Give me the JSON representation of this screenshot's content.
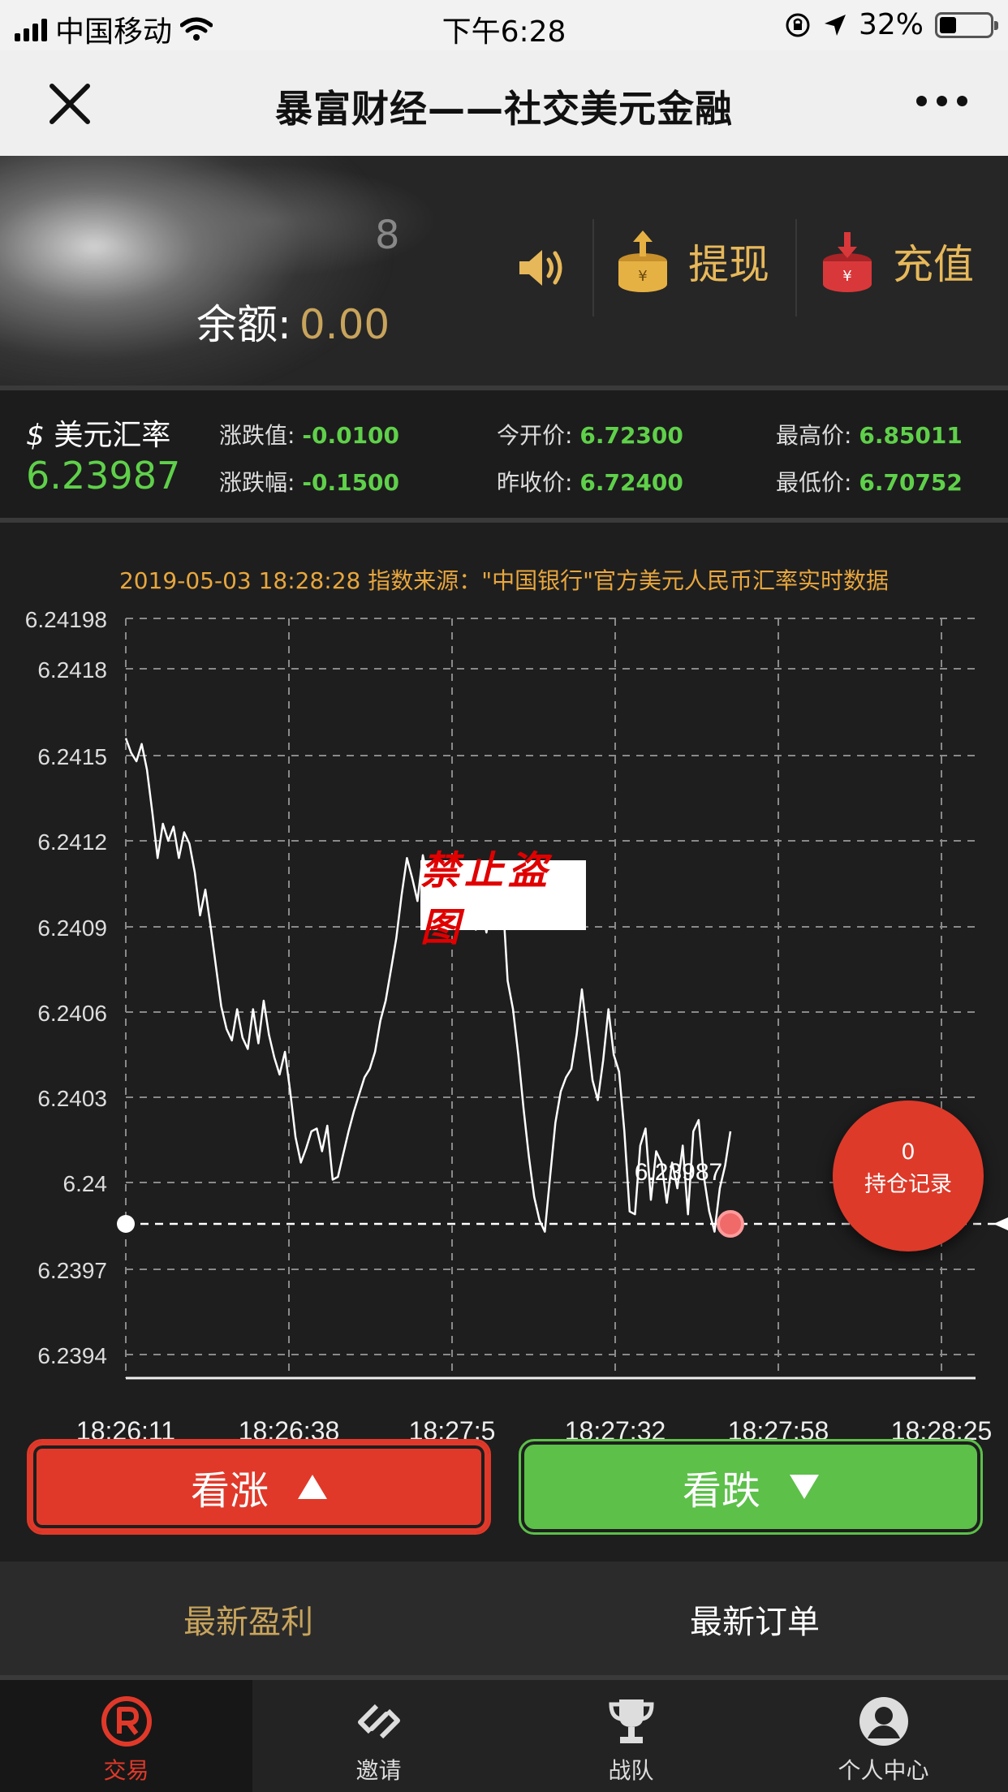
{
  "status_bar": {
    "carrier": "中国移动",
    "time": "下午6:28",
    "battery": "32%",
    "battery_level": 0.32
  },
  "nav": {
    "title": "暴富财经——社交美元金融",
    "close_icon": "close-icon",
    "more_icon": "more-icon"
  },
  "header": {
    "uid": "8",
    "balance_label": "余额:",
    "balance_value": "0.00",
    "withdraw_label": "提现",
    "recharge_label": "充值",
    "colors": {
      "gold": "#e7b85a",
      "coin": "#e6b143",
      "red_coin": "#d9383a"
    }
  },
  "rate": {
    "symbol": "$",
    "label": "美元汇率",
    "price": "6.23987",
    "change_label": "涨跌值:",
    "change_value": "-0.0100",
    "change_pct_label": "涨跌幅:",
    "change_pct_value": "-0.1500",
    "open_label": "今开价:",
    "open_value": "6.72300",
    "prev_close_label": "昨收价:",
    "prev_close_value": "6.72400",
    "high_label": "最高价:",
    "high_value": "6.85011",
    "low_label": "最低价:",
    "low_value": "6.70752",
    "colors": {
      "up_green": "#5fd04a"
    }
  },
  "chart_header": {
    "source": "2019-05-03 18:28:28 指数来源：\"中国银行\"官方美元人民币汇率实时数据"
  },
  "chart_data": {
    "type": "line",
    "y_ticks": [
      "6.24198",
      "6.2418",
      "6.2415",
      "6.2412",
      "6.2409",
      "6.2406",
      "6.2403",
      "6.24",
      "6.2397",
      "6.2394"
    ],
    "x_ticks": [
      "18:26:11",
      "18:26:38",
      "18:27:5",
      "18:27:32",
      "18:27:58",
      "18:28:25"
    ],
    "ylim": [
      6.2394,
      6.24198
    ],
    "current_value": 6.23987,
    "current_label": "6.23987",
    "grid": true,
    "series": [
      {
        "values": [
          6.24156,
          6.24151,
          6.24148,
          6.24154,
          6.24145,
          6.2413,
          6.24114,
          6.24126,
          6.2412,
          6.24125,
          6.24114,
          6.24123,
          6.24119,
          6.24109,
          6.24094,
          6.24103,
          6.2409,
          6.24076,
          6.24062,
          6.24054,
          6.2405,
          6.24061,
          6.24051,
          6.24047,
          6.24061,
          6.24049,
          6.24064,
          6.24052,
          6.24044,
          6.24038,
          6.24046,
          6.24032,
          6.24016,
          6.24007,
          6.24012,
          6.24018,
          6.24019,
          6.24011,
          6.2402,
          6.24001,
          6.24002,
          6.2401,
          6.24018,
          6.24025,
          6.24031,
          6.24037,
          6.2404,
          6.24046,
          6.24057,
          6.24064,
          6.24075,
          6.24086,
          6.24101,
          6.24114,
          6.24107,
          6.24099,
          6.24115,
          6.24106,
          6.24103,
          6.24097,
          6.24094,
          6.24101,
          6.24102,
          6.24099,
          6.24093,
          6.24103,
          6.24089,
          6.24096,
          6.24088,
          6.24101,
          6.2411,
          6.24102,
          6.24071,
          6.24061,
          6.24045,
          6.24026,
          6.24009,
          6.23995,
          6.23987,
          6.23983,
          6.24002,
          6.24021,
          6.24032,
          6.24037,
          6.2404,
          6.24052,
          6.24068,
          6.24052,
          6.24036,
          6.24029,
          6.24043,
          6.24061,
          6.24045,
          6.24039,
          6.24018,
          6.2399,
          6.23989,
          6.24013,
          6.24019,
          6.23994,
          6.24011,
          6.24007,
          6.23993,
          6.24007,
          6.23998,
          6.24013,
          6.23989,
          6.24018,
          6.24022,
          6.24002,
          6.2399,
          6.23983,
          6.23998,
          6.24006,
          6.24018
        ]
      }
    ]
  },
  "watermark": "禁止盗图",
  "hold_badge": {
    "count": "0",
    "label": "持仓记录",
    "color": "#dd3a2a"
  },
  "actions": {
    "buy_up_label": "看涨",
    "buy_down_label": "看跌",
    "colors": {
      "up": "#e0392a",
      "down": "#5cc049"
    }
  },
  "tabs": [
    {
      "label": "最新盈利",
      "active": true
    },
    {
      "label": "最新订单",
      "active": false
    }
  ],
  "bottom_nav": [
    {
      "label": "交易",
      "icon": "registered-icon",
      "active": true
    },
    {
      "label": "邀请",
      "icon": "link-icon",
      "active": false
    },
    {
      "label": "战队",
      "icon": "trophy-icon",
      "active": false
    },
    {
      "label": "个人中心",
      "icon": "user-icon",
      "active": false
    }
  ]
}
